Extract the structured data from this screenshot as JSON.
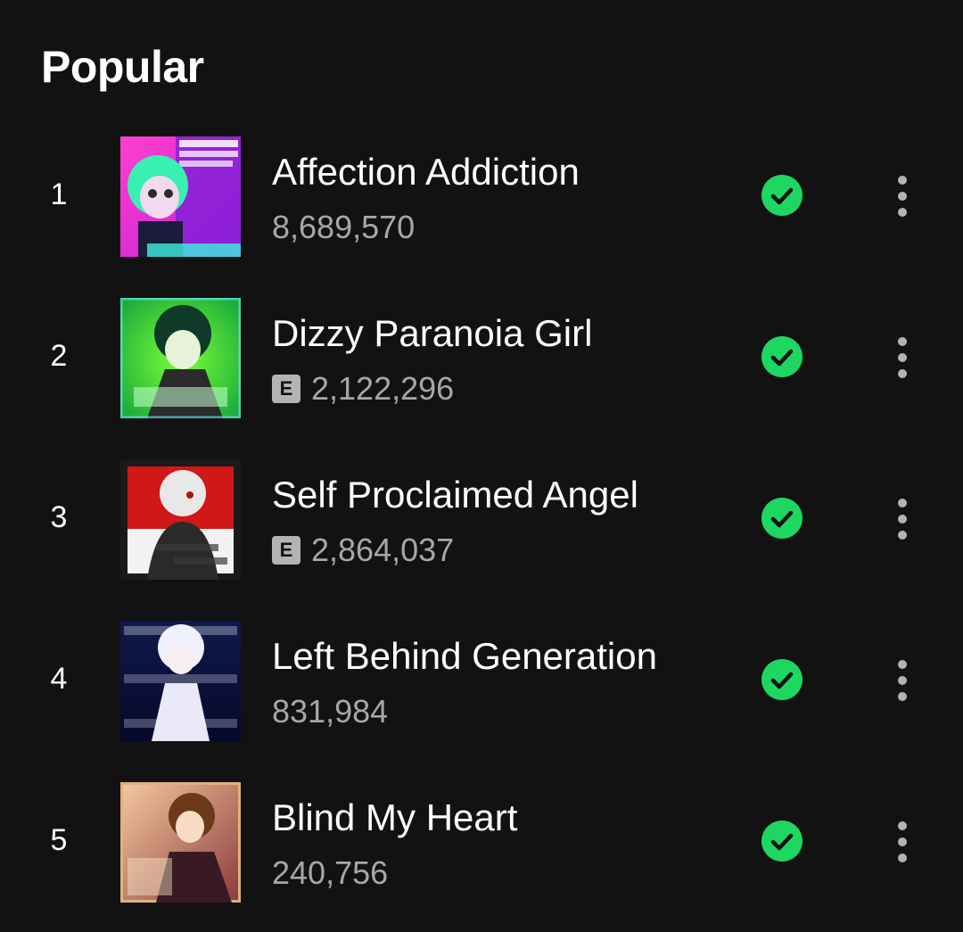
{
  "section": {
    "title": "Popular"
  },
  "colors": {
    "background": "#121212",
    "accent": "#1ed760",
    "text_primary": "#ffffff",
    "text_secondary": "#a7a7a7",
    "explicit_badge": "#b3b3b3"
  },
  "icons": {
    "saved": "check-circle-icon",
    "more": "more-vertical-icon",
    "explicit": "explicit-badge"
  },
  "tracks": [
    {
      "rank": "1",
      "title": "Affection Addiction",
      "plays": "8,689,570",
      "explicit": false,
      "explicit_label": "",
      "saved": true
    },
    {
      "rank": "2",
      "title": "Dizzy Paranoia Girl",
      "plays": "2,122,296",
      "explicit": true,
      "explicit_label": "E",
      "saved": true
    },
    {
      "rank": "3",
      "title": "Self Proclaimed Angel",
      "plays": "2,864,037",
      "explicit": true,
      "explicit_label": "E",
      "saved": true
    },
    {
      "rank": "4",
      "title": "Left Behind Generation",
      "plays": "831,984",
      "explicit": false,
      "explicit_label": "",
      "saved": true
    },
    {
      "rank": "5",
      "title": "Blind My Heart",
      "plays": "240,756",
      "explicit": false,
      "explicit_label": "",
      "saved": true
    }
  ]
}
